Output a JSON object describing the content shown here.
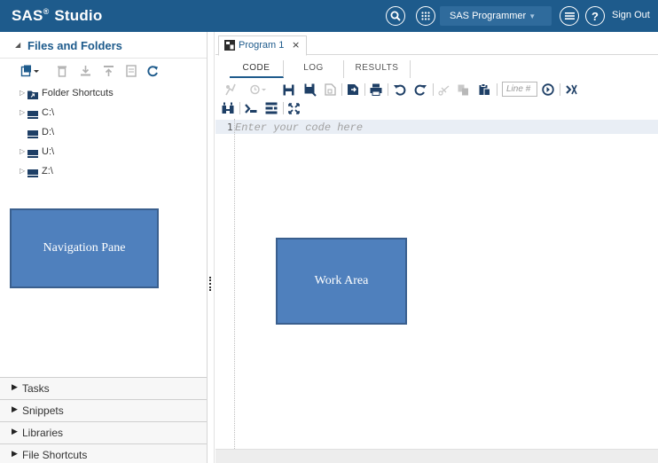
{
  "topbar": {
    "brand": "SAS",
    "brand_sup": "®",
    "brand_suffix": "Studio",
    "role_label": "SAS Programmer",
    "signout_label": "Sign Out",
    "icons": [
      "search-icon",
      "apps-icon",
      "menu-icon",
      "help-icon"
    ],
    "help_glyph": "?"
  },
  "nav": {
    "header_title": "Files and Folders",
    "toolbar_icons": [
      "new-icon",
      "delete-icon",
      "download-icon",
      "upload-icon",
      "properties-icon",
      "refresh-icon"
    ],
    "tree": [
      {
        "label": "Folder Shortcuts",
        "icon": "shortcut-folder-icon",
        "expandable": true
      },
      {
        "label": "C:\\",
        "icon": "drive-icon",
        "expandable": true
      },
      {
        "label": "D:\\",
        "icon": "drive-icon",
        "expandable": false
      },
      {
        "label": "U:\\",
        "icon": "drive-icon",
        "expandable": true
      },
      {
        "label": "Z:\\",
        "icon": "drive-icon",
        "expandable": true
      }
    ],
    "callout_label": "Navigation Pane",
    "accordion": [
      {
        "label": "Tasks"
      },
      {
        "label": "Snippets"
      },
      {
        "label": "Libraries"
      },
      {
        "label": "File Shortcuts"
      }
    ]
  },
  "work": {
    "tab_label": "Program 1",
    "tab_close": "×",
    "subtabs": [
      "CODE",
      "LOG",
      "RESULTS"
    ],
    "active_subtab": "CODE",
    "line_input_placeholder": "Line #",
    "line_number": "1",
    "editor_placeholder": "Enter your code here",
    "callout_label": "Work Area"
  },
  "colors": {
    "topbar": "#1e5b8c",
    "accent": "#1e5b8c",
    "callout": "#4f80bd",
    "active_line": "#e9eef5"
  }
}
